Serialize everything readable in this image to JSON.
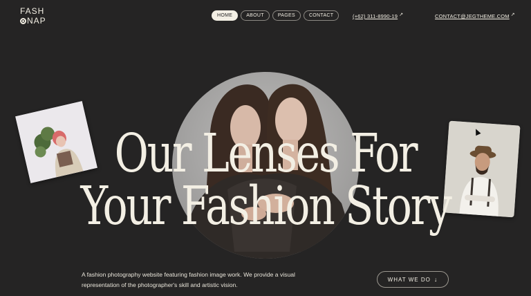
{
  "logo": {
    "line1": "FASH",
    "line2_rest": "NAP"
  },
  "nav": [
    {
      "label": "HOME",
      "active": true
    },
    {
      "label": "ABOUT",
      "active": false
    },
    {
      "label": "PAGES",
      "active": false
    },
    {
      "label": "CONTACT",
      "active": false
    }
  ],
  "header": {
    "phone": "(+62) 311-8990-19",
    "email": "CONTACT@JEGTHEME.COM",
    "arrow_icon": "arrow-up-right-icon"
  },
  "hero": {
    "headline_line1": "Our Lenses For",
    "headline_line2": "Your Fashion Story",
    "description": "A fashion photography website featuring fashion image work. We provide a visual representation of the photographer's skill and artistic vision.",
    "cta_label": "WHAT WE DO",
    "cta_icon": "arrow-down-icon"
  },
  "colors": {
    "background": "#252424",
    "text": "#f3efe4",
    "accent": "#f3efe4"
  }
}
